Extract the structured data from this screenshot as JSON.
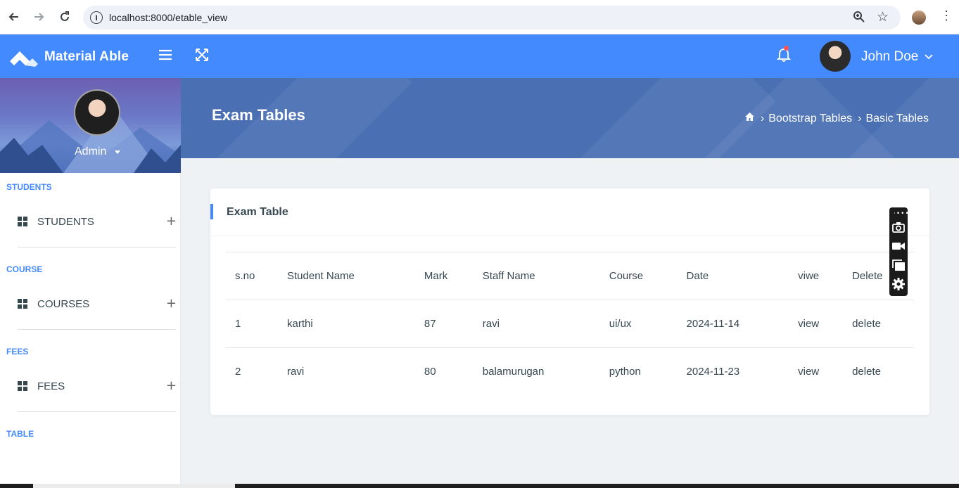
{
  "browser": {
    "url": "localhost:8000/etable_view"
  },
  "header": {
    "brand": "Material Able",
    "user_name": "John Doe",
    "accent": "#448aff"
  },
  "sidebar": {
    "profile_name": "Admin",
    "sections": [
      {
        "heading": "STUDENTS",
        "item": "STUDENTS"
      },
      {
        "heading": "COURSE",
        "item": "COURSES"
      },
      {
        "heading": "FEES",
        "item": "FEES"
      },
      {
        "heading": "TABLE"
      }
    ]
  },
  "banner": {
    "title": "Exam Tables",
    "breadcrumb": [
      "Bootstrap Tables",
      "Basic Tables"
    ]
  },
  "card": {
    "title": "Exam Table",
    "columns": [
      "s.no",
      "Student Name",
      "Mark",
      "Staff Name",
      "Course",
      "Date",
      "viwe",
      "Delete"
    ],
    "rows": [
      [
        "1",
        "karthi",
        "87",
        "ravi",
        "ui/ux",
        "2024-11-14",
        "view",
        "delete"
      ],
      [
        "2",
        "ravi",
        "80",
        "balamurugan",
        "python",
        "2024-11-23",
        "view",
        "delete"
      ]
    ]
  },
  "icons": {
    "sidebar_item": "grid-icon",
    "expand": "plus-icon",
    "notifications": "bell-icon",
    "home": "home-icon",
    "recorder": [
      "camera-icon",
      "video-icon",
      "window-icon",
      "settings-icon"
    ]
  }
}
